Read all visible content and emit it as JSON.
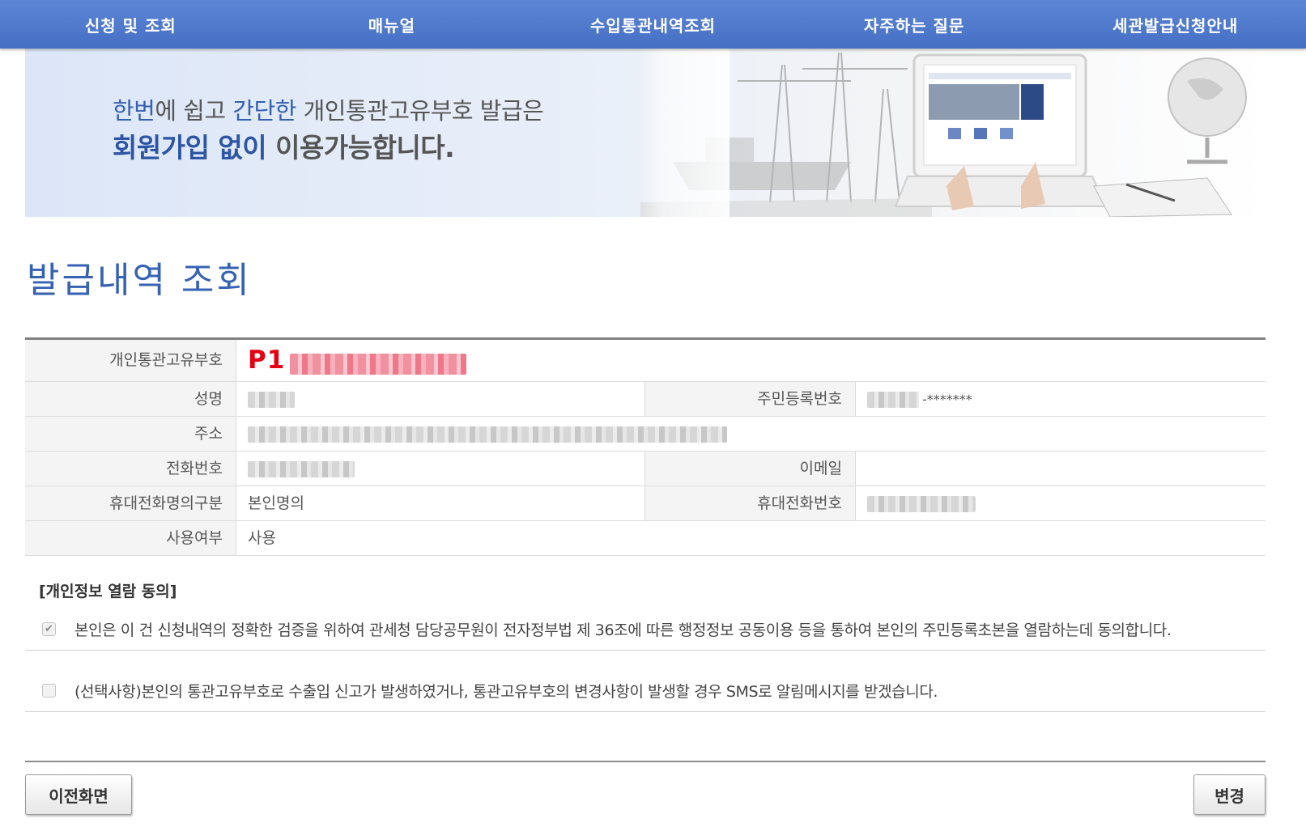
{
  "nav": {
    "items": [
      "신청 및 조회",
      "매뉴얼",
      "수입통관내역조회",
      "자주하는 질문",
      "세관발급신청안내"
    ]
  },
  "banner": {
    "line1_pre": "한번",
    "line1_a": "에 쉽고 ",
    "line1_hl": "간단한",
    "line1_post": " 개인통관고유부호 발급은",
    "line2_hl": "회원가입 없이",
    "line2_post": " 이용가능합니다."
  },
  "page_title": "발급내역 조회",
  "info": {
    "customs_id_label": "개인통관고유부호",
    "customs_id_prefix": "P1",
    "name_label": "성명",
    "rrn_label": "주민등록번호",
    "rrn_mask": "-*******",
    "address_label": "주소",
    "phone_label": "전화번호",
    "email_label": "이메일",
    "mobile_owner_label": "휴대전화명의구분",
    "mobile_owner_value": "본인명의",
    "mobile_label": "휴대전화번호",
    "usage_label": "사용여부",
    "usage_value": "사용"
  },
  "consent": {
    "title": "[개인정보 열람 동의]",
    "item1_checked": true,
    "item1_text": "본인은 이 건 신청내역의 정확한 검증을 위하여 관세청 담당공무원이 전자정부법 제 36조에 따른 행정정보 공동이용 등을 통하여 본인의 주민등록초본을 열람하는데 동의합니다.",
    "item2_checked": false,
    "item2_text": "(선택사항)본인의 통관고유부호로 수출입 신고가 발생하였거나, 통관고유부호의 변경사항이 발생할 경우 SMS로 알림메시지를 받겠습니다."
  },
  "buttons": {
    "prev_label": "이전화면",
    "change_label": "변경"
  }
}
